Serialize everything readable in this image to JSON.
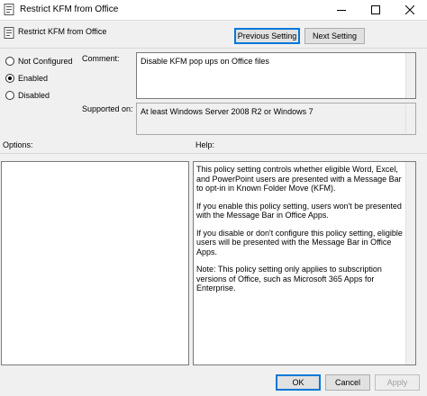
{
  "window": {
    "title": "Restrict KFM from Office",
    "icon": "policy-document-icon",
    "controls": [
      "minimize-icon",
      "maximize-icon",
      "close-icon"
    ]
  },
  "header": {
    "policy_name": "Restrict KFM from Office",
    "previous_setting": "Previous Setting",
    "next_setting": "Next Setting"
  },
  "state": {
    "options": [
      {
        "label": "Not Configured",
        "checked": false
      },
      {
        "label": "Enabled",
        "checked": true
      },
      {
        "label": "Disabled",
        "checked": false
      }
    ]
  },
  "comment": {
    "label": "Comment:",
    "value": "Disable KFM pop ups on Office files"
  },
  "supported_on": {
    "label": "Supported on:",
    "value": "At least Windows Server 2008 R2 or Windows 7"
  },
  "sections": {
    "options_label": "Options:",
    "help_label": "Help:"
  },
  "help": {
    "paragraphs": [
      "This policy setting controls whether eligible Word, Excel, and PowerPoint users are presented with a Message Bar to opt-in in Known Folder Move (KFM).",
      "If you enable this policy setting, users won't be presented with the Message Bar in Office Apps.",
      "If you disable or don't configure this policy setting, eligible users will be presented with the Message Bar in Office Apps.",
      "Note: This policy setting only applies to subscription versions of Office, such as Microsoft 365 Apps for Enterprise."
    ]
  },
  "footer": {
    "ok": "OK",
    "cancel": "Cancel",
    "apply": "Apply"
  },
  "colors": {
    "accent": "#0078d7",
    "background": "#f0f0f0"
  }
}
